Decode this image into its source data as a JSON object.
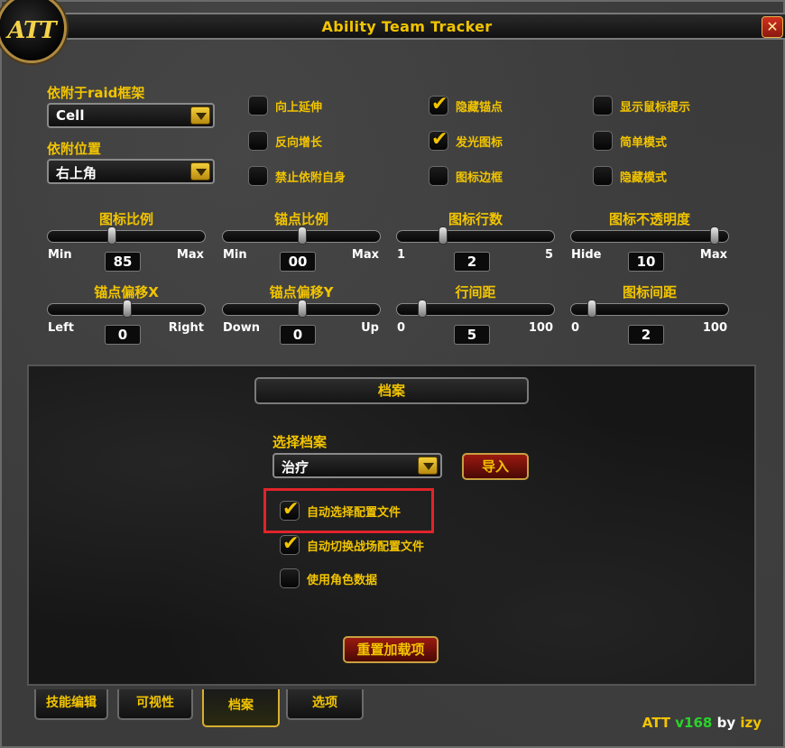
{
  "window": {
    "title": "Ability Team Tracker",
    "close_glyph": "✕",
    "logo_text": "ATT"
  },
  "attach": {
    "frame_label": "依附于raid框架",
    "frame_value": "Cell",
    "position_label": "依附位置",
    "position_value": "右上角"
  },
  "checkboxes": [
    {
      "label": "向上延伸",
      "checked": false
    },
    {
      "label": "反向增长",
      "checked": false
    },
    {
      "label": "禁止依附自身",
      "checked": false
    },
    {
      "label": "隐藏锚点",
      "checked": true
    },
    {
      "label": "发光图标",
      "checked": true
    },
    {
      "label": "图标边框",
      "checked": false
    },
    {
      "label": "显示鼠标提示",
      "checked": false
    },
    {
      "label": "简单模式",
      "checked": false
    },
    {
      "label": "隐藏模式",
      "checked": false
    }
  ],
  "sliders": [
    {
      "title": "图标比例",
      "min": "Min",
      "max": "Max",
      "value": "85",
      "position": 0.4
    },
    {
      "title": "锚点比例",
      "min": "Min",
      "max": "Max",
      "value": "00",
      "position": 0.5
    },
    {
      "title": "图标行数",
      "min": "1",
      "max": "5",
      "value": "2",
      "position": 0.28
    },
    {
      "title": "图标不透明度",
      "min": "Hide",
      "max": "Max",
      "value": "10",
      "position": 0.93
    },
    {
      "title": "锚点偏移X",
      "min": "Left",
      "max": "Right",
      "value": "0",
      "position": 0.5
    },
    {
      "title": "锚点偏移Y",
      "min": "Down",
      "max": "Up",
      "value": "0",
      "position": 0.5
    },
    {
      "title": "行间距",
      "min": "0",
      "max": "100",
      "value": "5",
      "position": 0.14
    },
    {
      "title": "图标间距",
      "min": "0",
      "max": "100",
      "value": "2",
      "position": 0.11
    }
  ],
  "profile": {
    "section_title": "档案",
    "select_label": "选择档案",
    "select_value": "治疗",
    "import_label": "导入",
    "auto_select_label": "自动选择配置文件",
    "auto_select_checked": true,
    "auto_switch_label": "自动切换战场配置文件",
    "auto_switch_checked": true,
    "use_char_label": "使用角色数据",
    "use_char_checked": false,
    "reset_label": "重置加载项"
  },
  "tabs": [
    {
      "label": "技能编辑",
      "active": false
    },
    {
      "label": "可视性",
      "active": false
    },
    {
      "label": "档案",
      "active": true
    },
    {
      "label": "选项",
      "active": false
    }
  ],
  "footer": {
    "name": "ATT",
    "version": "v168",
    "by": "by",
    "author": "izy"
  },
  "colors": {
    "accent": "#f2c400",
    "highlight": "#e0242a",
    "version": "#2ad42a"
  }
}
